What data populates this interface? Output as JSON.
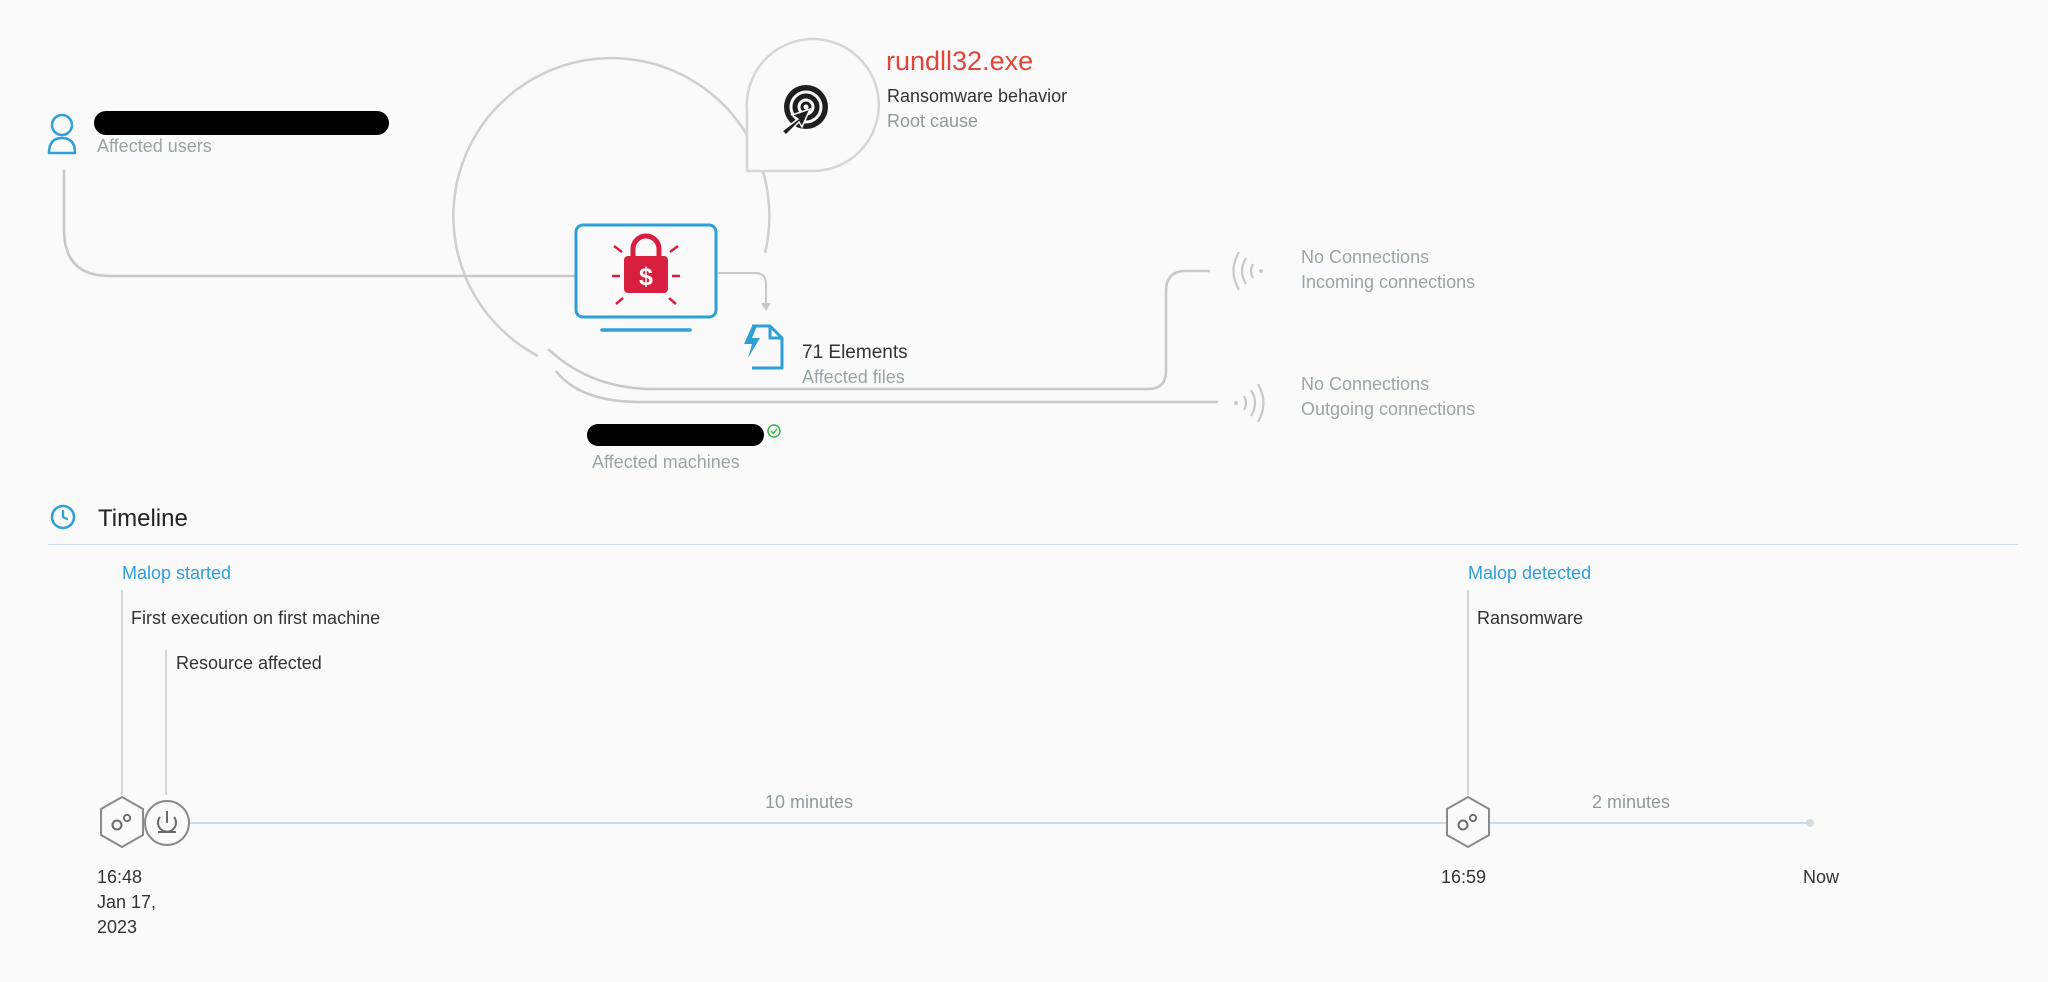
{
  "root_cause": {
    "process_name": "rundll32.exe",
    "behavior": "Ransomware behavior",
    "label": "Root cause",
    "icon": "target-icon"
  },
  "affected_users": {
    "label": "Affected users",
    "icon": "user-icon"
  },
  "machine": {
    "label": "Affected machines",
    "icon": "ransomware-laptop-icon",
    "status_icon": "check-circle-icon"
  },
  "affected_files": {
    "count_label": "71 Elements",
    "label": "Affected files",
    "icon": "file-icon"
  },
  "incoming": {
    "status": "No Connections",
    "label": "Incoming connections",
    "icon": "incoming-signal-icon"
  },
  "outgoing": {
    "status": "No Connections",
    "label": "Outgoing connections",
    "icon": "outgoing-signal-icon"
  },
  "timeline": {
    "title": "Timeline",
    "icon": "clock-icon",
    "malop_started": "Malop started",
    "first_execution": "First execution on first machine",
    "resource_affected": "Resource affected",
    "malop_detected": "Malop detected",
    "ransomware": "Ransomware",
    "duration_1": "10 minutes",
    "duration_2": "2 minutes",
    "start_time": "16:48",
    "start_date_line1": "Jan 17,",
    "start_date_line2": "2023",
    "detect_time": "16:59",
    "now_label": "Now"
  },
  "colors": {
    "accent_blue": "#2f9fd8",
    "alert_red": "#e0463a",
    "ransomware_red": "#d81f3f",
    "line_gray": "#c8c8c8",
    "text_dark": "#333333",
    "text_gray": "#8f9aa0"
  }
}
